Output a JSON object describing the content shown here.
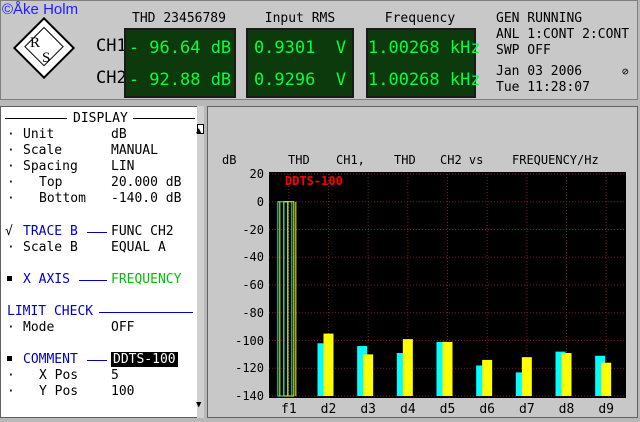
{
  "copyright": "©Åke Holm",
  "header": {
    "ch1_label": "CH1",
    "ch2_label": "CH2",
    "col_thd_title": "THD 23456789",
    "col_rms_title": "Input RMS",
    "col_freq_title": "Frequency",
    "ch1_thd": "- 96.64 dB",
    "ch2_thd": "- 92.88 dB",
    "ch1_rms": "0.9301  V",
    "ch2_rms": "0.9296  V",
    "ch1_freq": "1.00268 kHz",
    "ch2_freq": "1.00268 kHz",
    "gen_status": "GEN RUNNING",
    "anl_status": "ANL 1:CONT 2:CONT",
    "swp_status": "SWP OFF",
    "date": "Jan 03 2006",
    "time": "Tue 11:28:07"
  },
  "side_panel": {
    "title": "DISPLAY",
    "unit_label": "Unit",
    "unit_value": "dB",
    "scale_label": "Scale",
    "scale_value": "MANUAL",
    "spacing_label": "Spacing",
    "spacing_value": "LIN",
    "top_label": "Top",
    "top_value": "20.000 dB",
    "bottom_label": "Bottom",
    "bottom_value": "-140.0 dB",
    "trace_b_label": "TRACE B",
    "trace_b_value": "FUNC CH2",
    "scale_b_label": "Scale B",
    "scale_b_value": "EQUAL A",
    "x_axis_label": "X AXIS",
    "x_axis_value": "FREQUENCY",
    "limit_check_label": "LIMIT CHECK",
    "mode_label": "Mode",
    "mode_value": "OFF",
    "comment_label": "COMMENT",
    "comment_value": "DDTS-100",
    "xpos_label": "X Pos",
    "xpos_value": "5",
    "ypos_label": "Y Pos",
    "ypos_value": "100"
  },
  "plot_header": {
    "unit": "dB",
    "t1": "THD",
    "t2": "CH1,",
    "t3": "THD",
    "t4": "CH2 vs",
    "t5": "FREQUENCY/Hz"
  },
  "colors": {
    "ch1": "#00ffff",
    "ch2": "#ffff00",
    "comment": "#ff0000",
    "readout_text": "#00ff40"
  },
  "chart_data": {
    "type": "bar",
    "categories": [
      "f1",
      "d2",
      "d3",
      "d4",
      "d5",
      "d6",
      "d7",
      "d8",
      "d9"
    ],
    "series": [
      {
        "values": [
          0,
          -102,
          -104,
          -109,
          -101,
          -118,
          -123,
          -108,
          -111
        ]
      },
      {
        "values": [
          0,
          -95,
          -110,
          -99,
          -101,
          -114,
          -112,
          -109,
          -116
        ]
      }
    ],
    "y_ticks": [
      "20",
      "0",
      "-20",
      "-40",
      "-60",
      "-80",
      "-100",
      "-120",
      "-140"
    ],
    "ylim": [
      -140,
      20
    ],
    "annotation": "DDTS-100",
    "grid": true
  }
}
